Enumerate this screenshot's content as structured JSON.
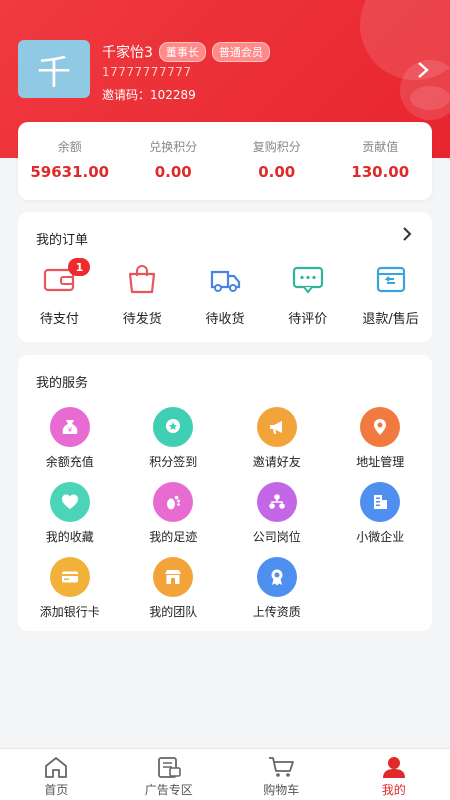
{
  "profile": {
    "avatar_char": "千",
    "name": "千家怡3",
    "badges": [
      "董事长",
      "普通会员"
    ],
    "phone": "17777777777",
    "invite_code": "邀请码：102289"
  },
  "stats": [
    {
      "label": "余额",
      "value": "59631.00"
    },
    {
      "label": "兑换积分",
      "value": "0.00"
    },
    {
      "label": "复购积分",
      "value": "0.00"
    },
    {
      "label": "贡献值",
      "value": "130.00"
    }
  ],
  "orders": {
    "title": "我的订单",
    "items": [
      {
        "label": "待支付",
        "icon": "wallet-icon",
        "badge": "1"
      },
      {
        "label": "待发货",
        "icon": "bag-icon"
      },
      {
        "label": "待收货",
        "icon": "truck-icon"
      },
      {
        "label": "待评价",
        "icon": "comment-icon"
      },
      {
        "label": "退款/售后",
        "icon": "refund-box-icon"
      }
    ]
  },
  "services": {
    "title": "我的服务",
    "items": [
      {
        "label": "余额充值",
        "icon": "money-bag-icon",
        "color": "#e86bd1"
      },
      {
        "label": "积分签到",
        "icon": "badge-star-icon",
        "color": "#3fcfb4"
      },
      {
        "label": "邀请好友",
        "icon": "megaphone-icon",
        "color": "#f2a33a"
      },
      {
        "label": "地址管理",
        "icon": "location-pin-icon",
        "color": "#f07a3f"
      },
      {
        "label": "我的收藏",
        "icon": "heart-icon",
        "color": "#4cd4b8"
      },
      {
        "label": "我的足迹",
        "icon": "footprint-icon",
        "color": "#e86bd1"
      },
      {
        "label": "公司岗位",
        "icon": "org-chart-icon",
        "color": "#c367e6"
      },
      {
        "label": "小微企业",
        "icon": "building-icon",
        "color": "#4e8ff0"
      },
      {
        "label": "添加银行卡",
        "icon": "bank-card-icon",
        "color": "#f2b23a"
      },
      {
        "label": "我的团队",
        "icon": "shop-icon",
        "color": "#f2a33a"
      },
      {
        "label": "上传资质",
        "icon": "certificate-icon",
        "color": "#4e8ff0"
      }
    ]
  },
  "tabbar": [
    {
      "label": "首页",
      "icon": "home-icon"
    },
    {
      "label": "广告专区",
      "icon": "ad-zone-icon"
    },
    {
      "label": "购物车",
      "icon": "cart-icon"
    },
    {
      "label": "我的",
      "icon": "user-icon",
      "active": true
    }
  ],
  "colors": {
    "primary": "#e8252f",
    "value_red": "#e02a2a"
  }
}
